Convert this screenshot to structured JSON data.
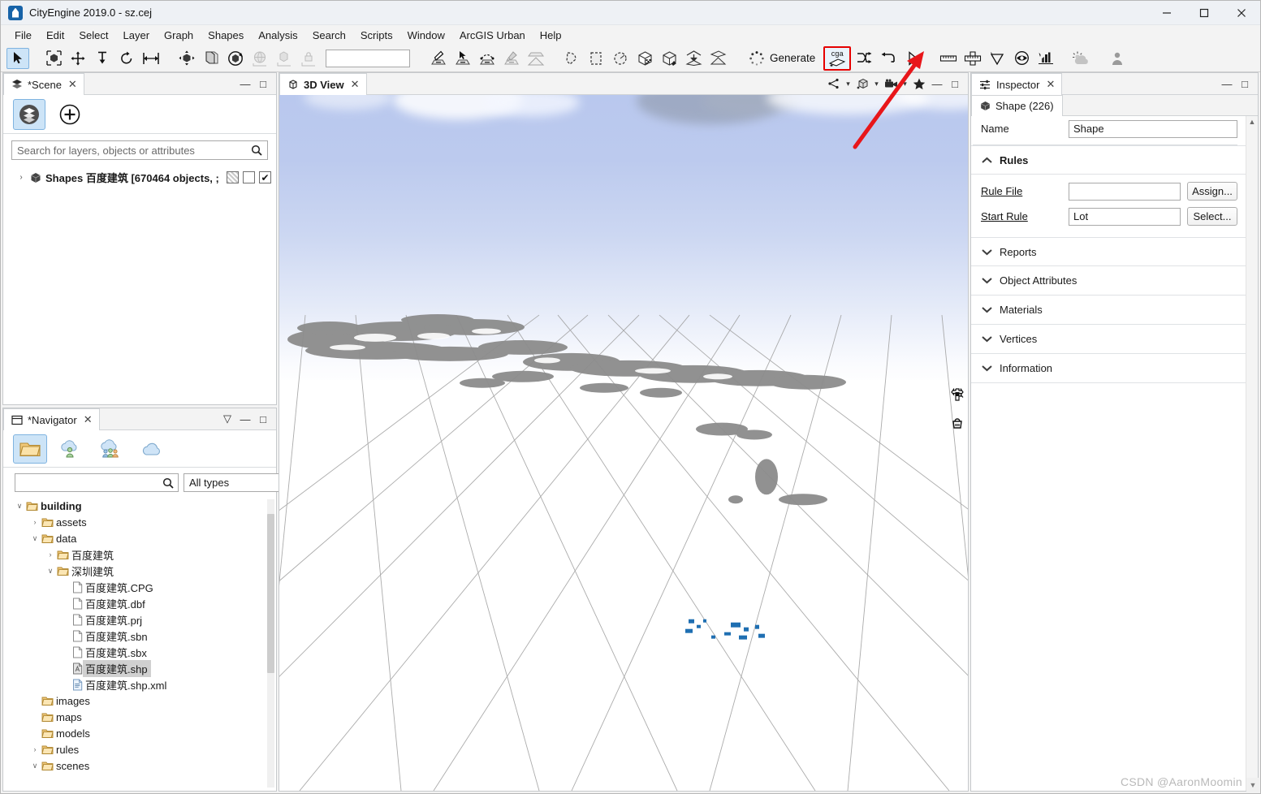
{
  "window": {
    "title": "CityEngine 2019.0 - sz.cej",
    "app_icon": "cityengine-logo-icon",
    "minimize": "—",
    "maximize": "□",
    "close": "✕"
  },
  "menubar": {
    "items": [
      {
        "label": "File"
      },
      {
        "label": "Edit"
      },
      {
        "label": "Select"
      },
      {
        "label": "Layer"
      },
      {
        "label": "Graph"
      },
      {
        "label": "Shapes"
      },
      {
        "label": "Analysis"
      },
      {
        "label": "Search"
      },
      {
        "label": "Scripts"
      },
      {
        "label": "Window"
      },
      {
        "label": "ArcGIS Urban"
      },
      {
        "label": "Help"
      }
    ]
  },
  "toolbar": {
    "generate_label": "Generate",
    "cga_label": "cga",
    "search_value": "",
    "groups": [
      {
        "name": "selection",
        "buttons": [
          {
            "icon": "select-arrow-icon",
            "active": true
          },
          {
            "icon": "marquee-select-icon",
            "active": false
          }
        ]
      },
      {
        "name": "transform",
        "buttons": [
          {
            "icon": "move-icon",
            "active": false
          },
          {
            "icon": "align-down-icon",
            "active": false
          },
          {
            "icon": "rotate-icon",
            "active": false
          },
          {
            "icon": "scale-icon",
            "active": false
          }
        ]
      },
      {
        "name": "object-ops",
        "buttons": [
          {
            "icon": "push-pull-icon",
            "active": false
          },
          {
            "icon": "duplicate-icon",
            "active": false
          },
          {
            "icon": "rotate-object-icon",
            "active": false
          },
          {
            "icon": "globe-locate-icon",
            "active": false
          },
          {
            "icon": "object-axes-icon",
            "active": false
          },
          {
            "icon": "lock-axes-icon",
            "active": false
          }
        ]
      },
      {
        "name": "street-tools",
        "buttons": [
          {
            "icon": "polyline-street-icon",
            "active": false
          },
          {
            "icon": "street-cursor-icon",
            "active": false
          },
          {
            "icon": "curved-street-icon",
            "active": false
          },
          {
            "icon": "street-cleanup-icon",
            "active": false
          },
          {
            "icon": "terrain-street-icon",
            "active": false
          }
        ]
      },
      {
        "name": "shape-tools",
        "buttons": [
          {
            "icon": "polygonal-shape-icon",
            "active": false
          },
          {
            "icon": "rectangular-shape-icon",
            "active": false
          },
          {
            "icon": "circular-shape-icon",
            "active": false
          },
          {
            "icon": "texture-cube-icon",
            "active": false
          },
          {
            "icon": "paint-cube-icon",
            "active": false
          },
          {
            "icon": "align-shapes-up-icon",
            "active": false
          },
          {
            "icon": "align-shapes-terrain-icon",
            "active": false
          }
        ]
      },
      {
        "name": "generate",
        "buttons": [
          {
            "icon": "generate-spinner-icon",
            "active": false
          },
          {
            "icon": "cga-new-rule-icon",
            "active": false,
            "highlighted": true
          },
          {
            "icon": "shuffle-seed-icon",
            "active": false
          },
          {
            "icon": "undo-rule-icon",
            "active": false
          },
          {
            "icon": "play-cursor-icon",
            "active": false
          }
        ]
      },
      {
        "name": "analysis",
        "buttons": [
          {
            "icon": "measure-ruler-icon",
            "active": false
          },
          {
            "icon": "measure-area-icon",
            "active": false
          },
          {
            "icon": "viewshed-cone-icon",
            "active": false
          },
          {
            "icon": "shadow-eye-icon",
            "active": false
          },
          {
            "icon": "bar-chart-icon",
            "active": false
          }
        ]
      },
      {
        "name": "environment",
        "buttons": [
          {
            "icon": "weather-cloud-icon",
            "active": false
          }
        ]
      },
      {
        "name": "account",
        "buttons": [
          {
            "icon": "person-account-icon",
            "active": false
          }
        ]
      }
    ]
  },
  "scene_panel": {
    "tab_label": "*Scene",
    "tab_icon": "layers-stack-icon",
    "close_icon": "✕",
    "minimize_icon": "—",
    "maximize_icon": "□",
    "tools": [
      {
        "icon": "scene-layers-icon",
        "selected": true
      },
      {
        "icon": "add-layer-plus-icon",
        "selected": false
      }
    ],
    "search_placeholder": "Search for layers, objects or attributes",
    "search_value": "",
    "search_icon": "search-icon",
    "layers": [
      {
        "twisty": "›",
        "icon": "shape-cube-icon",
        "name": "Shapes 百度建筑 [670464 objects, ;",
        "hatched_checked": true,
        "box_checked": false,
        "visible_checked": true,
        "tick": "✔"
      }
    ]
  },
  "navigator_panel": {
    "tab_label": "*Navigator",
    "tab_icon": "folder-window-icon",
    "menu_icon": "▽",
    "minimize_icon": "—",
    "maximize_icon": "□",
    "close_icon": "✕",
    "tools": [
      {
        "icon": "open-folder-icon",
        "selected": true
      },
      {
        "icon": "my-content-cloud-icon",
        "selected": false
      },
      {
        "icon": "shared-content-cloud-icon",
        "selected": false
      },
      {
        "icon": "public-cloud-icon",
        "selected": false
      }
    ],
    "search_value": "",
    "search_icon": "search-icon",
    "filter_value": "All types",
    "filter_caret": "∨",
    "tree": [
      {
        "depth": 0,
        "twisty": "∨",
        "icon": "folder-icon",
        "label": "building",
        "bold": true,
        "selected": false
      },
      {
        "depth": 1,
        "twisty": "›",
        "icon": "folder-icon",
        "label": "assets",
        "bold": false,
        "selected": false
      },
      {
        "depth": 1,
        "twisty": "∨",
        "icon": "folder-icon",
        "label": "data",
        "bold": false,
        "selected": false
      },
      {
        "depth": 2,
        "twisty": "›",
        "icon": "folder-icon",
        "label": "百度建筑",
        "bold": false,
        "selected": false
      },
      {
        "depth": 2,
        "twisty": "∨",
        "icon": "folder-icon",
        "label": "深圳建筑",
        "bold": false,
        "selected": false
      },
      {
        "depth": 3,
        "twisty": "",
        "icon": "file-icon",
        "label": "百度建筑.CPG",
        "bold": false,
        "selected": false
      },
      {
        "depth": 3,
        "twisty": "",
        "icon": "file-icon",
        "label": "百度建筑.dbf",
        "bold": false,
        "selected": false
      },
      {
        "depth": 3,
        "twisty": "",
        "icon": "file-icon",
        "label": "百度建筑.prj",
        "bold": false,
        "selected": false
      },
      {
        "depth": 3,
        "twisty": "",
        "icon": "file-icon",
        "label": "百度建筑.sbn",
        "bold": false,
        "selected": false
      },
      {
        "depth": 3,
        "twisty": "",
        "icon": "file-icon",
        "label": "百度建筑.sbx",
        "bold": false,
        "selected": false
      },
      {
        "depth": 3,
        "twisty": "",
        "icon": "shapefile-icon",
        "label": "百度建筑.shp",
        "bold": false,
        "selected": true
      },
      {
        "depth": 3,
        "twisty": "",
        "icon": "xml-file-icon",
        "label": "百度建筑.shp.xml",
        "bold": false,
        "selected": false
      },
      {
        "depth": 1,
        "twisty": "",
        "icon": "folder-icon",
        "label": "images",
        "bold": false,
        "selected": false
      },
      {
        "depth": 1,
        "twisty": "",
        "icon": "folder-icon",
        "label": "maps",
        "bold": false,
        "selected": false
      },
      {
        "depth": 1,
        "twisty": "",
        "icon": "folder-icon",
        "label": "models",
        "bold": false,
        "selected": false
      },
      {
        "depth": 1,
        "twisty": "›",
        "icon": "folder-icon",
        "label": "rules",
        "bold": false,
        "selected": false
      },
      {
        "depth": 1,
        "twisty": "∨",
        "icon": "folder-icon",
        "label": "scenes",
        "bold": false,
        "selected": false
      }
    ]
  },
  "view_panel": {
    "tab_label": "3D View",
    "tab_icon": "cube-3d-icon",
    "close_icon": "✕",
    "minimize_icon": "—",
    "maximize_icon": "□",
    "toolbar_buttons": [
      {
        "icon": "share-graph-icon",
        "caret": "▾"
      },
      {
        "icon": "model-display-icon",
        "caret": "▾"
      },
      {
        "icon": "camera-icon",
        "caret": "▾"
      },
      {
        "icon": "bookmark-star-icon",
        "caret": ""
      }
    ],
    "overlay_icons": [
      {
        "icon": "compass-navigation-icon"
      },
      {
        "icon": "model-hierarchy-icon"
      }
    ],
    "annotation": {
      "type": "red-arrow",
      "color": "#e8161a"
    }
  },
  "inspector_panel": {
    "tab_label": "Inspector",
    "tab_icon": "inspector-sliders-icon",
    "close_icon": "✕",
    "minimize_icon": "—",
    "maximize_icon": "□",
    "subtab_label": "Shape (226)",
    "subtab_icon": "shape-cube-icon",
    "name_label": "Name",
    "name_value": "Shape",
    "rules_section": {
      "title": "Rules",
      "chevron": "⌃",
      "rows": [
        {
          "label": "Rule File",
          "value": "",
          "button": "Assign..."
        },
        {
          "label": "Start Rule",
          "value": "Lot",
          "button": "Select..."
        }
      ]
    },
    "sections": [
      {
        "label": "Reports",
        "chevron": "⌄"
      },
      {
        "label": "Object Attributes",
        "chevron": "⌄"
      },
      {
        "label": "Materials",
        "chevron": "⌄"
      },
      {
        "label": "Vertices",
        "chevron": "⌄"
      },
      {
        "label": "Information",
        "chevron": "⌄"
      }
    ],
    "scroll_up": "▲",
    "scroll_down": "▼"
  },
  "watermark": {
    "text": "CSDN @AaronMoomin"
  },
  "colors": {
    "accent_selection": "#cde4f7",
    "annotation_red": "#e8161a",
    "highlight_border": "#e60000",
    "sky_top": "#b9c8ee",
    "shape_gray": "#8c8c8c",
    "shape_blue": "#1f6fb2",
    "grid_line": "#9a9a9a"
  }
}
